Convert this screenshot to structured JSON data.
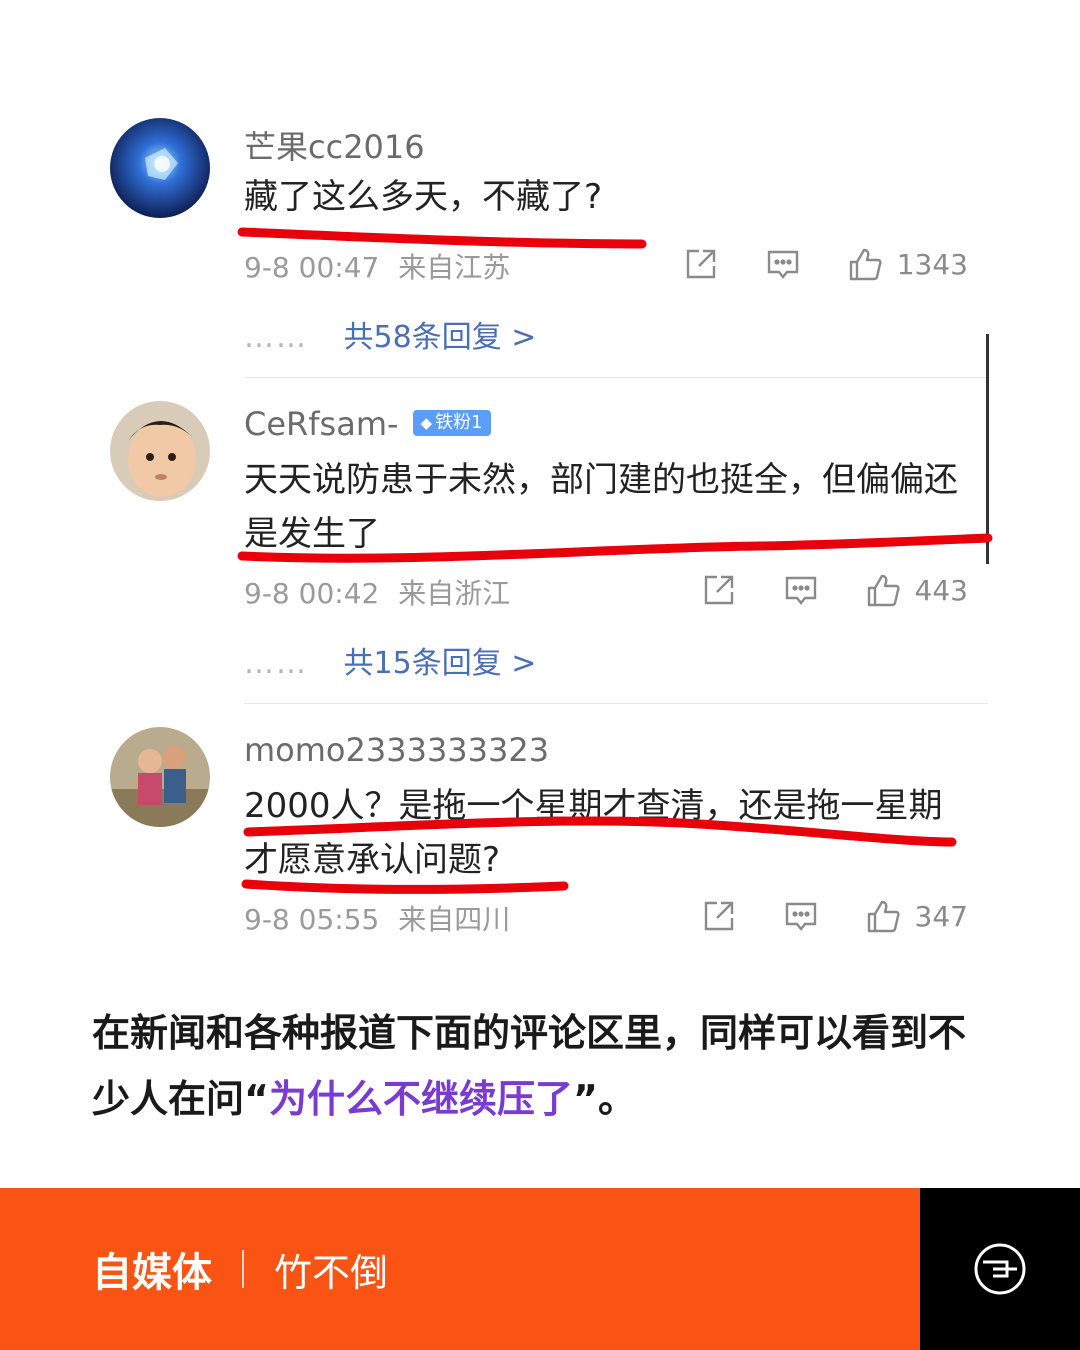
{
  "comments": [
    {
      "username": "芒果cc2016",
      "text": "藏了这么多天，不藏了?",
      "time": "9-8 00:47",
      "location": "来自江苏",
      "likes": "1343",
      "replies_dots": "……",
      "replies_label": "共58条回复 >"
    },
    {
      "username": "CeRfsam-",
      "badge": "铁粉1",
      "text": "天天说防患于未然，部门建的也挺全，但偏偏还是发生了",
      "time": "9-8 00:42",
      "location": "来自浙江",
      "likes": "443",
      "replies_dots": "……",
      "replies_label": "共15条回复 >"
    },
    {
      "username": "momo2333333323",
      "text": "2000人？是拖一个星期才查清，还是拖一星期才愿意承认问题?",
      "time": "9-8 05:55",
      "location": "来自四川",
      "likes": "347"
    }
  ],
  "caption": {
    "line_start": "在新闻和各种报道下面的评论区里，同样可以看到不少人在问“",
    "highlight": "为什么不继续压了",
    "line_end": "”。"
  },
  "footer": {
    "brand": "自媒体",
    "author": "竹不倒",
    "logo_icon": "circle-logo-icon"
  },
  "colors": {
    "accent_orange": "#fa5415",
    "highlight_purple": "#7a3bd1",
    "underline_red": "#e8000b",
    "link_blue": "#4a6fb4"
  },
  "icons": [
    "share-icon",
    "reply-icon",
    "thumbs-up-icon"
  ]
}
